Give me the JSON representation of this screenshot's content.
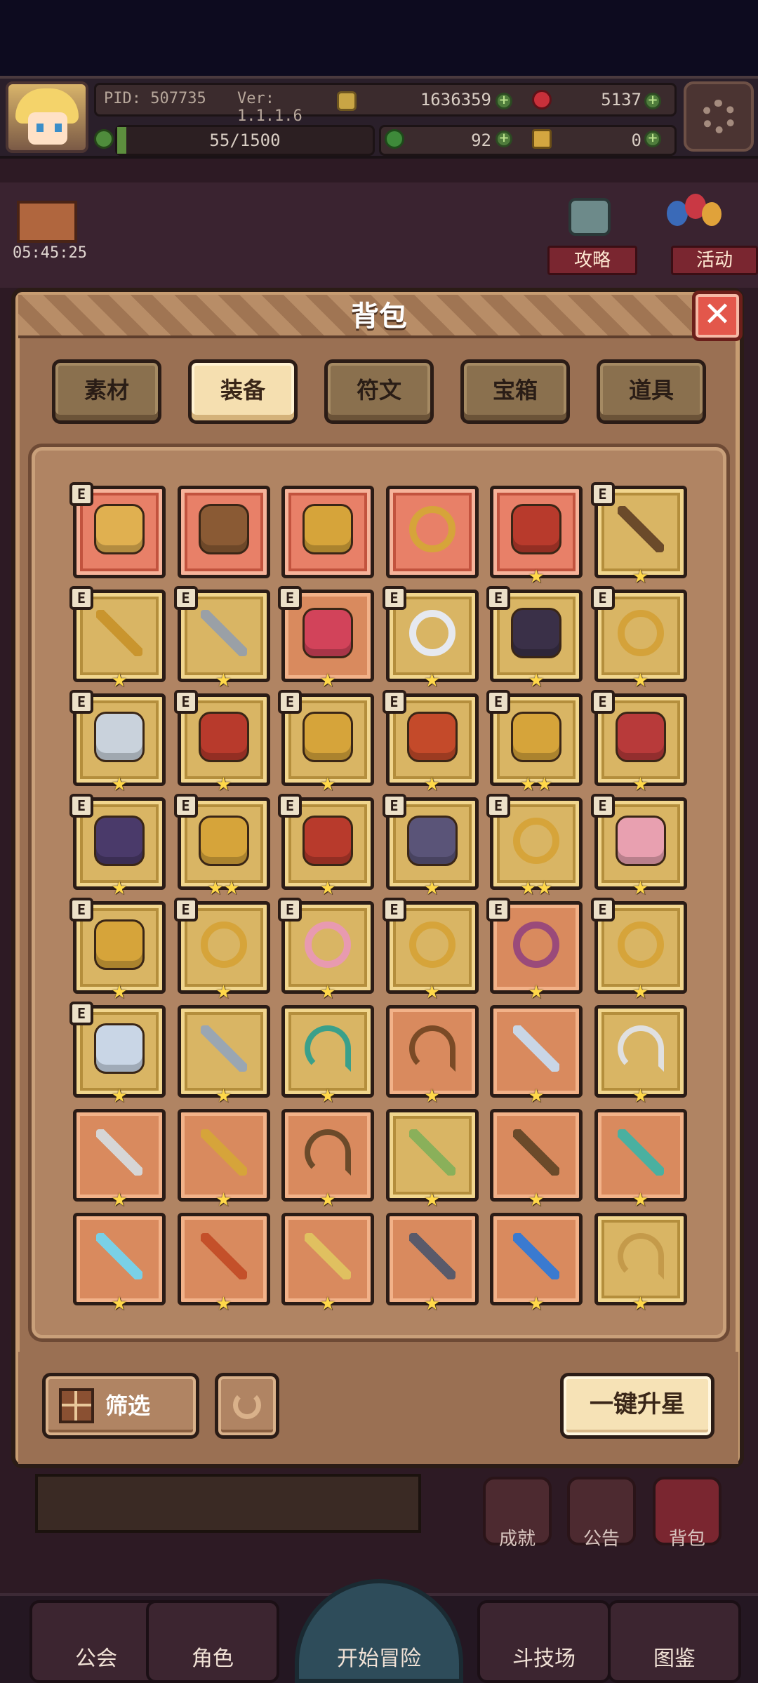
{
  "topbar": {
    "pid": "PID: 507735",
    "version": "Ver: 1.1.1.6",
    "gold": "1636359",
    "red_gem": "5137",
    "xp": "55/1500",
    "clover": "92",
    "ticket": "0",
    "timer": "05:45:25"
  },
  "side_buttons": {
    "guide": "攻略",
    "event": "活动"
  },
  "dialog": {
    "title": "背包",
    "tabs": [
      {
        "label": "素材",
        "active": false
      },
      {
        "label": "装备",
        "active": true
      },
      {
        "label": "符文",
        "active": false
      },
      {
        "label": "宝箱",
        "active": false
      },
      {
        "label": "道具",
        "active": false
      }
    ],
    "filter_label": "筛选",
    "upstar_label": "一键升星"
  },
  "items": [
    {
      "icon": "straw-hat-icon",
      "bg": "red",
      "equipped": true,
      "stars": ""
    },
    {
      "icon": "brown-armor-icon",
      "bg": "red",
      "equipped": false,
      "stars": ""
    },
    {
      "icon": "gold-horned-helm-icon",
      "bg": "red",
      "equipped": false,
      "stars": ""
    },
    {
      "icon": "gold-heart-amulet-icon",
      "bg": "red",
      "equipped": false,
      "stars": ""
    },
    {
      "icon": "red-gold-helmet-icon",
      "bg": "red",
      "equipped": false,
      "stars": "★"
    },
    {
      "icon": "blue-gem-staff-icon",
      "bg": "gold",
      "equipped": true,
      "stars": "★"
    },
    {
      "icon": "gold-scepter-icon",
      "bg": "gold",
      "equipped": true,
      "stars": "★"
    },
    {
      "icon": "battle-axe-icon",
      "bg": "gold",
      "equipped": true,
      "stars": "★"
    },
    {
      "icon": "teddy-bear-icon",
      "bg": "orange",
      "equipped": true,
      "stars": "★"
    },
    {
      "icon": "pearl-orb-icon",
      "bg": "gold",
      "equipped": true,
      "stars": "★"
    },
    {
      "icon": "witch-hat-icon",
      "bg": "gold",
      "equipped": true,
      "stars": "★"
    },
    {
      "icon": "gold-ring-icon",
      "bg": "gold",
      "equipped": true,
      "stars": "★"
    },
    {
      "icon": "silver-cape-icon",
      "bg": "gold",
      "equipped": true,
      "stars": "★"
    },
    {
      "icon": "red-robe-icon",
      "bg": "gold",
      "equipped": true,
      "stars": "★"
    },
    {
      "icon": "ruby-bracer-icon",
      "bg": "gold",
      "equipped": true,
      "stars": "★"
    },
    {
      "icon": "red-glove-icon",
      "bg": "gold",
      "equipped": true,
      "stars": "★"
    },
    {
      "icon": "gold-tiara-icon",
      "bg": "gold",
      "equipped": true,
      "stars": "★★"
    },
    {
      "icon": "ruby-crown-icon",
      "bg": "gold",
      "equipped": true,
      "stars": "★"
    },
    {
      "icon": "purple-crown-icon",
      "bg": "gold",
      "equipped": true,
      "stars": "★"
    },
    {
      "icon": "gold-boots-icon",
      "bg": "gold",
      "equipped": true,
      "stars": "★★"
    },
    {
      "icon": "red-boots-icon",
      "bg": "gold",
      "equipped": true,
      "stars": "★"
    },
    {
      "icon": "iron-boots-icon",
      "bg": "gold",
      "equipped": true,
      "stars": "★"
    },
    {
      "icon": "gold-emblem-icon",
      "bg": "gold",
      "equipped": true,
      "stars": "★★"
    },
    {
      "icon": "pink-heart-shield-icon",
      "bg": "gold",
      "equipped": true,
      "stars": "★"
    },
    {
      "icon": "gem-cross-icon",
      "bg": "gold",
      "equipped": true,
      "stars": "★"
    },
    {
      "icon": "gold-necklace-icon",
      "bg": "gold",
      "equipped": true,
      "stars": "★"
    },
    {
      "icon": "heart-necklace-icon",
      "bg": "gold",
      "equipped": true,
      "stars": "★"
    },
    {
      "icon": "jewel-necklace-icon",
      "bg": "gold",
      "equipped": true,
      "stars": "★"
    },
    {
      "icon": "winged-heart-ring-icon",
      "bg": "orange",
      "equipped": true,
      "stars": "★"
    },
    {
      "icon": "gold-knuckle-ring-icon",
      "bg": "gold",
      "equipped": true,
      "stars": "★"
    },
    {
      "icon": "silver-helm-icon",
      "bg": "gold",
      "equipped": true,
      "stars": "★"
    },
    {
      "icon": "crossed-swords-icon",
      "bg": "gold",
      "equipped": false,
      "stars": "★"
    },
    {
      "icon": "jade-bow-icon",
      "bg": "gold",
      "equipped": false,
      "stars": "★"
    },
    {
      "icon": "crossbow-icon",
      "bg": "orange",
      "equipped": false,
      "stars": "★"
    },
    {
      "icon": "steel-sword-icon",
      "bg": "orange",
      "equipped": false,
      "stars": "★"
    },
    {
      "icon": "silver-bow-icon",
      "bg": "gold",
      "equipped": false,
      "stars": "★"
    },
    {
      "icon": "double-axe-icon",
      "bg": "orange",
      "equipped": false,
      "stars": "★"
    },
    {
      "icon": "gold-staff-icon",
      "bg": "orange",
      "equipped": false,
      "stars": "★"
    },
    {
      "icon": "wood-bow-icon",
      "bg": "orange",
      "equipped": false,
      "stars": "★"
    },
    {
      "icon": "green-mace-icon",
      "bg": "gold",
      "equipped": false,
      "stars": "★"
    },
    {
      "icon": "wood-club-icon",
      "bg": "orange",
      "equipped": false,
      "stars": "★"
    },
    {
      "icon": "teal-club-icon",
      "bg": "orange",
      "equipped": false,
      "stars": "★"
    },
    {
      "icon": "ice-wand-icon",
      "bg": "orange",
      "equipped": false,
      "stars": "★"
    },
    {
      "icon": "flame-sword-icon",
      "bg": "orange",
      "equipped": false,
      "stars": "★"
    },
    {
      "icon": "gold-sword-icon",
      "bg": "orange",
      "equipped": false,
      "stars": "★"
    },
    {
      "icon": "dark-dagger-icon",
      "bg": "orange",
      "equipped": false,
      "stars": "★"
    },
    {
      "icon": "sapphire-staff-icon",
      "bg": "orange",
      "equipped": false,
      "stars": "★"
    },
    {
      "icon": "gold-crossbow-icon",
      "bg": "gold",
      "equipped": false,
      "stars": "★"
    }
  ],
  "behind": {
    "achievement": "成就",
    "notice": "公告",
    "bag": "背包"
  },
  "bottom_nav": [
    "公会",
    "角色",
    "开始冒险",
    "斗技场",
    "图鉴"
  ]
}
